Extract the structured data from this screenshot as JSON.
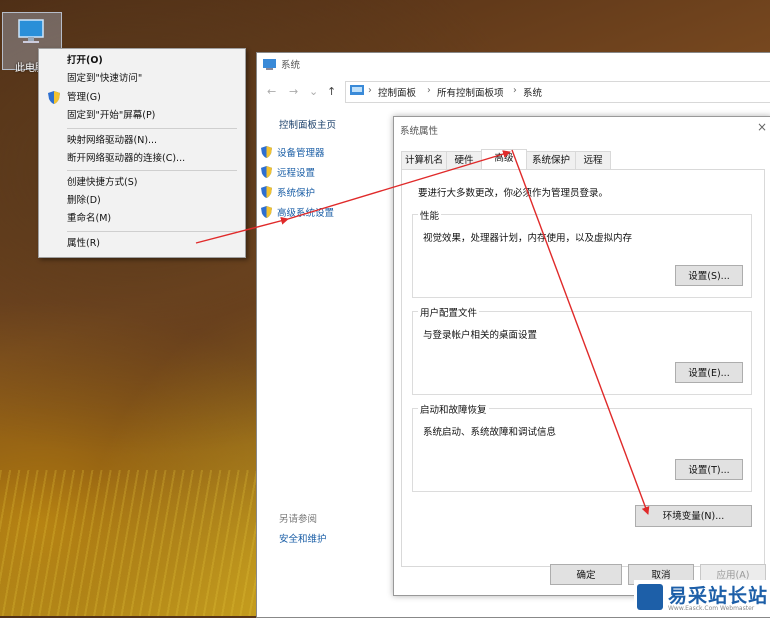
{
  "desktop": {
    "icon_label": "此电脑"
  },
  "context_menu": {
    "items": [
      {
        "label": "打开(O)",
        "bold": true
      },
      {
        "label": "固定到\"快速访问\""
      },
      {
        "label": "管理(G)",
        "shield": true
      },
      {
        "label": "固定到\"开始\"屏幕(P)"
      },
      {
        "label": "映射网络驱动器(N)..."
      },
      {
        "label": "断开网络驱动器的连接(C)..."
      },
      {
        "label": "创建快捷方式(S)"
      },
      {
        "label": "删除(D)"
      },
      {
        "label": "重命名(M)"
      },
      {
        "label": "属性(R)"
      }
    ]
  },
  "system_window": {
    "title": "系统",
    "breadcrumb": [
      "控制面板",
      "所有控制面板项",
      "系统"
    ],
    "left_home": "控制面板主页",
    "left_links": [
      "设备管理器",
      "远程设置",
      "系统保护",
      "高级系统设置"
    ],
    "see_also_header": "另请参阅",
    "see_also_link": "安全和维护"
  },
  "dialog": {
    "title": "系统属性",
    "close_glyph": "×",
    "tabs": [
      "计算机名",
      "硬件",
      "高级",
      "系统保护",
      "远程"
    ],
    "active_tab": "高级",
    "note": "要进行大多数更改，你必须作为管理员登录。",
    "groups": [
      {
        "label": "性能",
        "desc": "视觉效果，处理器计划，内存使用，以及虚拟内存",
        "button": "设置(S)..."
      },
      {
        "label": "用户配置文件",
        "desc": "与登录帐户相关的桌面设置",
        "button": "设置(E)..."
      },
      {
        "label": "启动和故障恢复",
        "desc": "系统启动、系统故障和调试信息",
        "button": "设置(T)..."
      }
    ],
    "env_button": "环境变量(N)...",
    "ok": "确定",
    "cancel": "取消",
    "apply": "应用(A)"
  },
  "watermark": {
    "title": "易采站长站",
    "sub": "Www.Easck.Com Webmaster"
  },
  "colors": {
    "link": "#1a5ea6",
    "arrow": "#e02a2a",
    "brand": "#1d5fa8"
  }
}
